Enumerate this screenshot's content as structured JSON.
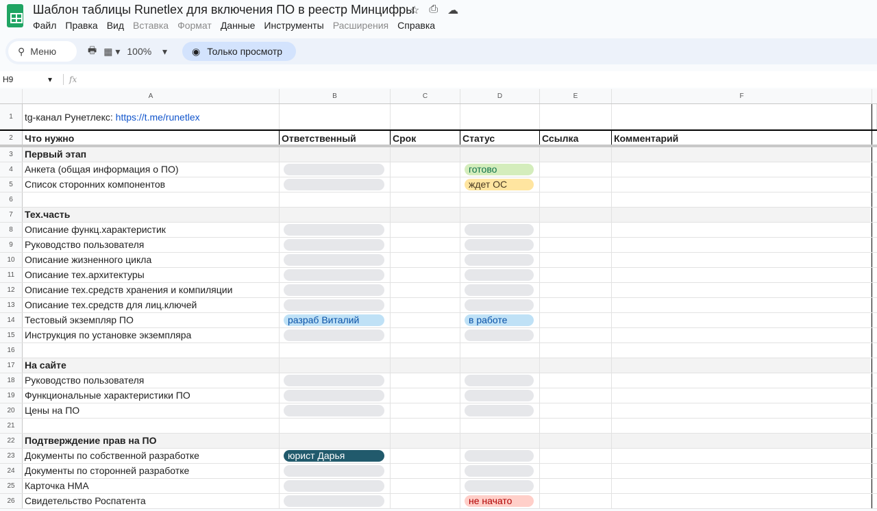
{
  "doc": {
    "title": "Шаблон таблицы Runetlex для включения ПО в реестр Минцифры"
  },
  "menu": [
    {
      "label": "Файл",
      "disabled": false
    },
    {
      "label": "Правка",
      "disabled": false
    },
    {
      "label": "Вид",
      "disabled": false
    },
    {
      "label": "Вставка",
      "disabled": true
    },
    {
      "label": "Формат",
      "disabled": true
    },
    {
      "label": "Данные",
      "disabled": false
    },
    {
      "label": "Инструменты",
      "disabled": false
    },
    {
      "label": "Расширения",
      "disabled": true
    },
    {
      "label": "Справка",
      "disabled": false
    }
  ],
  "toolbar": {
    "search": "Меню",
    "zoom": "100%",
    "view_only": "Только просмотр"
  },
  "formula": {
    "cell_ref": "H9",
    "fx": "fx"
  },
  "columns": [
    "A",
    "B",
    "C",
    "D",
    "E",
    "F"
  ],
  "row1": {
    "prefix": "tg-канал Рунетлекс: ",
    "link": "https://t.me/runetlex"
  },
  "header": [
    "Что нужно",
    "Ответственный",
    "Срок",
    "Статус",
    "Ссылка",
    "Комментарий"
  ],
  "rows": [
    {
      "n": 3,
      "a": "Первый этап",
      "sec": true
    },
    {
      "n": 4,
      "a": "Анкета (общая информация о ПО)",
      "b": {
        "t": "",
        "s": "empty"
      },
      "d": {
        "t": "готово",
        "s": "green"
      }
    },
    {
      "n": 5,
      "a": "Список сторонних компонентов",
      "b": {
        "t": "",
        "s": "empty"
      },
      "d": {
        "t": "ждет ОС",
        "s": "yellow"
      }
    },
    {
      "n": 6,
      "a": ""
    },
    {
      "n": 7,
      "a": "Тех.часть",
      "sec": true
    },
    {
      "n": 8,
      "a": "Описание функц.характеристик",
      "b": {
        "t": "",
        "s": "empty"
      },
      "d": {
        "t": "",
        "s": "empty"
      }
    },
    {
      "n": 9,
      "a": "Руководство пользователя",
      "b": {
        "t": "",
        "s": "empty"
      },
      "d": {
        "t": "",
        "s": "empty"
      }
    },
    {
      "n": 10,
      "a": "Описание жизненного цикла",
      "b": {
        "t": "",
        "s": "empty"
      },
      "d": {
        "t": "",
        "s": "empty"
      }
    },
    {
      "n": 11,
      "a": "Описание тех.архитектуры",
      "b": {
        "t": "",
        "s": "empty"
      },
      "d": {
        "t": "",
        "s": "empty"
      }
    },
    {
      "n": 12,
      "a": "Описание тех.средств хранения и компиляции",
      "b": {
        "t": "",
        "s": "empty"
      },
      "d": {
        "t": "",
        "s": "empty"
      }
    },
    {
      "n": 13,
      "a": "Описание тех.средств для лиц.ключей",
      "b": {
        "t": "",
        "s": "empty"
      },
      "d": {
        "t": "",
        "s": "empty"
      }
    },
    {
      "n": 14,
      "a": "Тестовый экземпляр ПО",
      "b": {
        "t": "разраб Виталий",
        "s": "blue"
      },
      "d": {
        "t": "в работе",
        "s": "blue"
      }
    },
    {
      "n": 15,
      "a": "Инструкция по установке экземпляра",
      "b": {
        "t": "",
        "s": "empty"
      },
      "d": {
        "t": "",
        "s": "empty"
      }
    },
    {
      "n": 16,
      "a": ""
    },
    {
      "n": 17,
      "a": "На сайте",
      "sec": true
    },
    {
      "n": 18,
      "a": "Руководство пользователя",
      "b": {
        "t": "",
        "s": "empty"
      },
      "d": {
        "t": "",
        "s": "empty"
      }
    },
    {
      "n": 19,
      "a": "Функциональные характеристики ПО",
      "b": {
        "t": "",
        "s": "empty"
      },
      "d": {
        "t": "",
        "s": "empty"
      }
    },
    {
      "n": 20,
      "a": "Цены на ПО",
      "b": {
        "t": "",
        "s": "empty"
      },
      "d": {
        "t": "",
        "s": "empty"
      }
    },
    {
      "n": 21,
      "a": ""
    },
    {
      "n": 22,
      "a": "Подтверждение прав на ПО",
      "sec": true
    },
    {
      "n": 23,
      "a": "Документы по собственной разработке",
      "b": {
        "t": "юрист Дарья",
        "s": "teal"
      },
      "d": {
        "t": "",
        "s": "empty"
      }
    },
    {
      "n": 24,
      "a": "Документы по сторонней разработке",
      "b": {
        "t": "",
        "s": "empty"
      },
      "d": {
        "t": "",
        "s": "empty"
      }
    },
    {
      "n": 25,
      "a": "Карточка НМА",
      "b": {
        "t": "",
        "s": "empty"
      },
      "d": {
        "t": "",
        "s": "empty"
      }
    },
    {
      "n": 26,
      "a": "Свидетельство Роспатента",
      "b": {
        "t": "",
        "s": "empty"
      },
      "d": {
        "t": "не начато",
        "s": "red"
      }
    }
  ]
}
